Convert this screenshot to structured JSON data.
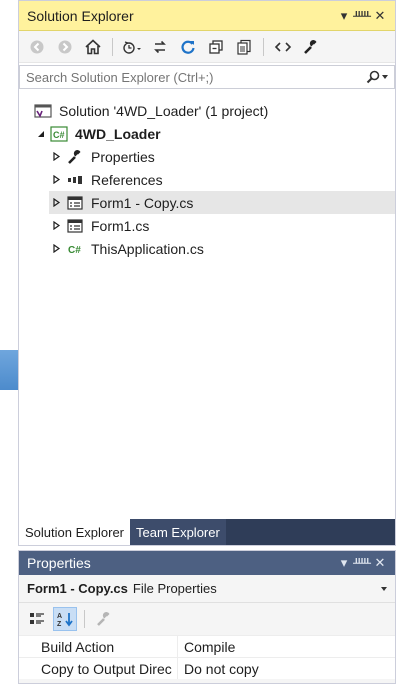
{
  "solution_explorer": {
    "title": "Solution Explorer",
    "controls": {
      "dropdown": "▾",
      "pin": "ᚊ",
      "close": "✕"
    },
    "search_placeholder": "Search Solution Explorer (Ctrl+;)",
    "tree": {
      "solution": "Solution '4WD_Loader' (1 project)",
      "project": "4WD_Loader",
      "items": [
        {
          "label": "Properties",
          "icon": "wrench-icon"
        },
        {
          "label": "References",
          "icon": "references-icon"
        },
        {
          "label": "Form1 - Copy.cs",
          "icon": "form-icon",
          "selected": true
        },
        {
          "label": "Form1.cs",
          "icon": "form-icon"
        },
        {
          "label": "ThisApplication.cs",
          "icon": "csharp-file-icon"
        }
      ]
    },
    "tabs": [
      "Solution Explorer",
      "Team Explorer"
    ]
  },
  "properties": {
    "title": "Properties",
    "object_name": "Form1 - Copy.cs",
    "object_type": "File Properties",
    "rows": [
      {
        "name": "Build Action",
        "value": "Compile"
      },
      {
        "name": "Copy to Output Direc",
        "value": "Do not copy"
      }
    ]
  },
  "colors": {
    "active_title": "#fff29d",
    "inactive_title": "#4d6082",
    "tab_strip": "#2f3d58",
    "arrow": "#5b9bd5"
  }
}
